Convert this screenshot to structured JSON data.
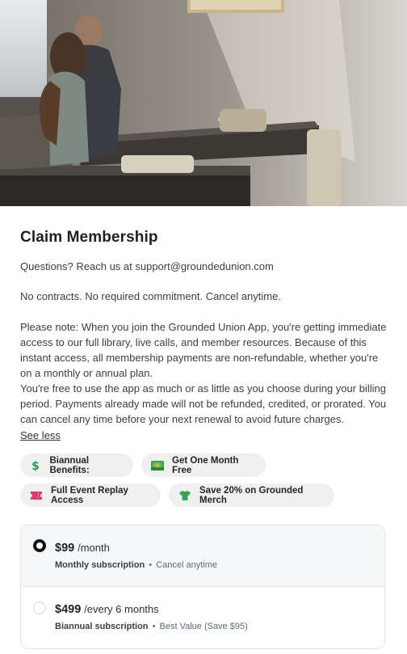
{
  "hero": {
    "image_alt": "Couple sitting at a sunlit table by a window"
  },
  "title": "Claim Membership",
  "questions_line": "Questions? Reach us at support@groundedunion.com",
  "no_contracts": "No contracts. No required commitment. Cancel anytime.",
  "note_part1": "Please note: When you join the Grounded Union App, you're getting immediate access to our full library, live calls, and member resources. Because of this instant access, all membership payments are non-refundable, whether you're on a monthly or annual plan.",
  "note_part2": "You're free to use the app as much or as little as you choose during your billing period. Payments already made will not be refunded, credited, or prorated. You can cancel any time before your next renewal to avoid future charges.",
  "see_less": "See less",
  "chips": [
    {
      "label": "Biannual Benefits:",
      "icon": "dollar-sign-icon"
    },
    {
      "label": "Get One Month Free",
      "icon": "money-bill-icon"
    },
    {
      "label": "Full Event Replay Access",
      "icon": "ticket-icon"
    },
    {
      "label": "Save 20% on Grounded Merch",
      "icon": "t-shirt-icon"
    }
  ],
  "plans": [
    {
      "price": "$99",
      "period": "/month",
      "name": "Monthly subscription",
      "separator": "•",
      "note": "Cancel anytime",
      "selected": true
    },
    {
      "price": "$499",
      "period": "/every 6 months",
      "name": "Biannual subscription",
      "separator": "•",
      "note": "Best Value (Save $95)",
      "selected": false
    }
  ],
  "colors": {
    "chip_bg": "#f0f0f1",
    "selected_plan_bg": "#f6f7f8",
    "dollar_green": "#1fa34a",
    "ticket_pink": "#e8356f",
    "shirt_green": "#2fa84f"
  }
}
